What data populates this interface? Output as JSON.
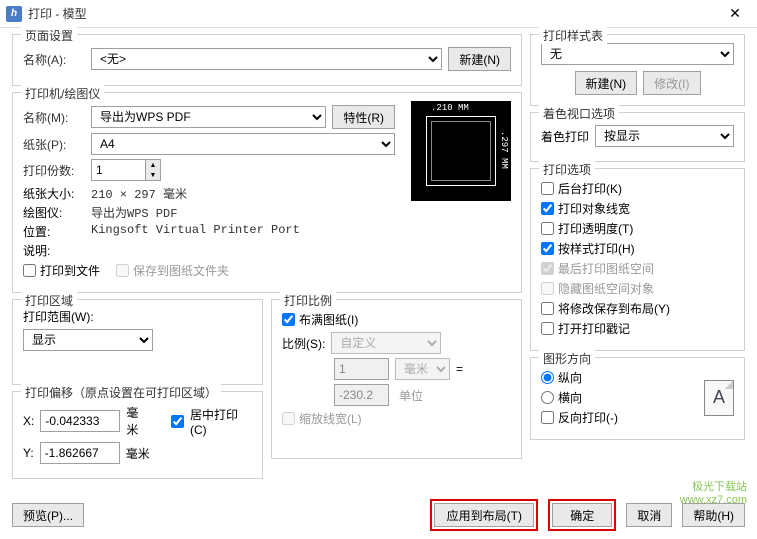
{
  "titlebar": {
    "icon": "h",
    "title": "打印 - 模型"
  },
  "page_setup": {
    "title": "页面设置",
    "name_label": "名称(A):",
    "name_value": "<无>",
    "new_btn": "新建(N)"
  },
  "printer": {
    "title": "打印机/绘图仪",
    "name_label": "名称(M):",
    "name_value": "导出为WPS PDF",
    "props_btn": "特性(R)",
    "paper_label": "纸张(P):",
    "paper_value": "A4",
    "copies_label": "打印份数:",
    "copies_value": "1",
    "papersize_label": "纸张大小:",
    "papersize_value": "210 × 297 毫米",
    "plotter_label": "绘图仪:",
    "plotter_value": "导出为WPS PDF",
    "position_label": "位置:",
    "position_value": "Kingsoft Virtual Printer Port",
    "desc_label": "说明:",
    "to_file": "打印到文件",
    "save_template": "保存到图纸文件夹",
    "preview_w": ".210 MM",
    "preview_h": ".297 MM"
  },
  "area": {
    "title": "打印区域",
    "range_label": "打印范围(W):",
    "range_value": "显示"
  },
  "scale": {
    "title": "打印比例",
    "fit": "布满图纸(I)",
    "ratio_label": "比例(S):",
    "ratio_value": "自定义",
    "val1": "1",
    "unit1": "毫米",
    "eq": "=",
    "val2": "-230.2",
    "unit2": "单位",
    "lineweight": "缩放线宽(L)"
  },
  "offset": {
    "title": "打印偏移（原点设置在可打印区域）",
    "x_label": "X:",
    "x_value": "-0.042333",
    "y_label": "Y:",
    "y_value": "-1.862667",
    "unit": "毫米",
    "center": "居中打印(C)"
  },
  "style": {
    "title": "打印样式表",
    "value": "无",
    "new_btn": "新建(N)",
    "modify_btn": "修改(I)"
  },
  "viewport": {
    "title": "着色视口选项",
    "label": "着色打印",
    "value": "按显示"
  },
  "options": {
    "title": "打印选项",
    "bg": "后台打印(K)",
    "lineweight": "打印对象线宽",
    "transparency": "打印透明度(T)",
    "bystyle": "按样式打印(H)",
    "paperspace": "最后打印图纸空间",
    "hidepaper": "隐藏图纸空间对象",
    "savelayout": "将修改保存到布局(Y)",
    "stamp": "打开打印戳记"
  },
  "orient": {
    "title": "图形方向",
    "portrait": "纵向",
    "landscape": "横向",
    "reverse": "反向打印(-)"
  },
  "footer": {
    "preview": "预览(P)...",
    "apply": "应用到布局(T)",
    "ok": "确定",
    "cancel": "取消",
    "help": "帮助(H)"
  },
  "watermark": {
    "line1": "极光下载站",
    "line2": "www.xz7.com"
  }
}
